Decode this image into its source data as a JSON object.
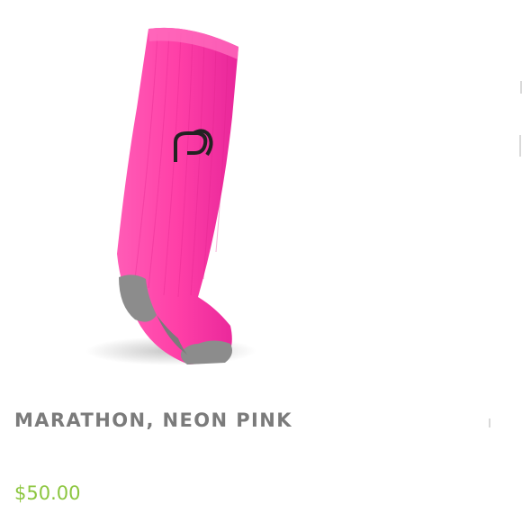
{
  "product": {
    "image_icon": "compression-sock-image",
    "name": "MARATHON, NEON PINK",
    "price": "$50.00",
    "colors": {
      "sock": "#ff3fa7",
      "sock_shade": "#e0238b",
      "heel_toe": "#8c8c8c",
      "title": "#7b7b7b",
      "price": "#8cc63f"
    }
  }
}
